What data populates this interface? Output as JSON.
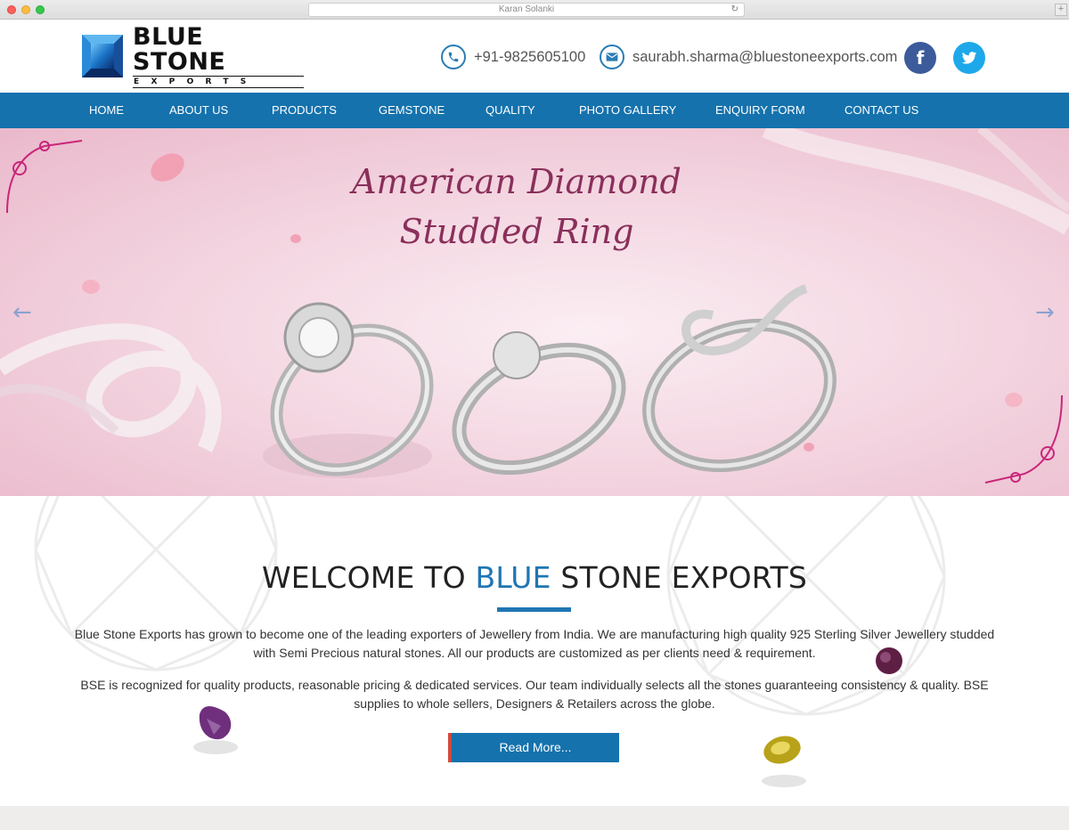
{
  "browser": {
    "tab_title": "Karan Solanki",
    "reload_icon": "reload-icon",
    "newtab_label": "+"
  },
  "header": {
    "logo_title": "BLUE STONE",
    "logo_subtitle": "EXPORTS",
    "phone": "+91-9825605100",
    "email": "saurabh.sharma@bluestoneexports.com",
    "facebook_label": "f",
    "twitter_label": "t"
  },
  "nav": {
    "items": [
      "HOME",
      "ABOUT US",
      "PRODUCTS",
      "GEMSTONE",
      "QUALITY",
      "PHOTO GALLERY",
      "ENQUIRY FORM",
      "CONTACT US"
    ]
  },
  "hero": {
    "title_line1": "American Diamond",
    "title_line2": "Studded Ring",
    "prev_label": "←",
    "next_label": "→"
  },
  "welcome": {
    "heading_pre": "WELCOME TO ",
    "heading_blue": "BLUE",
    "heading_post": " STONE EXPORTS",
    "para1": "Blue Stone Exports has grown to become one of the leading exporters of Jewellery from India. We are manufacturing high quality 925 Sterling Silver Jewellery studded with Semi Precious natural stones. All our products are customized as per clients need & requirement.",
    "para2": "BSE is recognized for quality products, reasonable pricing & dedicated services. Our team individually selects all the stones guaranteeing consistency & quality. BSE supplies to whole sellers, Designers & Retailers across the globe.",
    "button": "Read More..."
  },
  "colors": {
    "nav_blue": "#1572ad",
    "accent_blue": "#1f76b3",
    "facebook": "#3b5b9a",
    "twitter": "#1da8ea",
    "hero_title": "#8a2f5a"
  }
}
